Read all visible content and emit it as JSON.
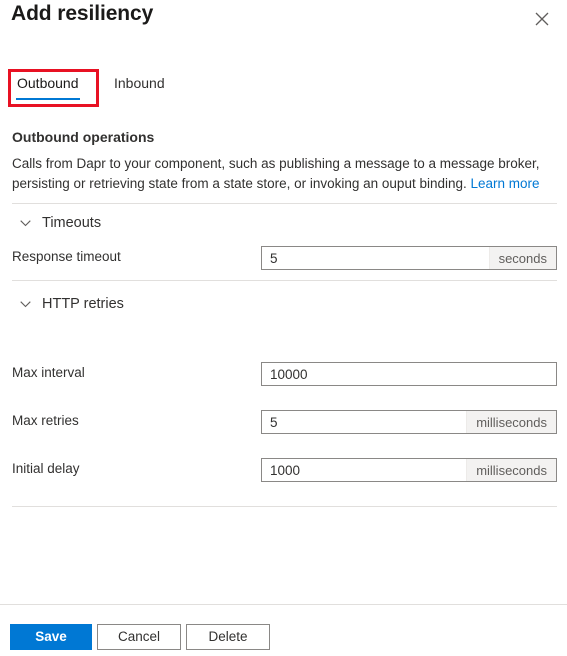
{
  "header": {
    "title": "Add resiliency",
    "close_icon": "close-icon"
  },
  "tabs": [
    {
      "id": "outbound",
      "label": "Outbound",
      "selected": true,
      "highlighted": true
    },
    {
      "id": "inbound",
      "label": "Inbound",
      "selected": false,
      "highlighted": false
    }
  ],
  "main": {
    "section_title": "Outbound operations",
    "description": "Calls from Dapr to your component, such as publishing a message to a message broker, persisting or retrieving state from a state store, or invoking an ouput binding.",
    "learn_more": "Learn more",
    "groups": [
      {
        "id": "timeouts",
        "label": "Timeouts",
        "expanded": true,
        "chevron_icon": "chevron-down-icon"
      },
      {
        "id": "http-retries",
        "label": "HTTP retries",
        "expanded": true,
        "chevron_icon": "chevron-down-icon"
      }
    ],
    "fields": [
      {
        "id": "response-timeout",
        "label": "Response timeout",
        "value": "5",
        "suffix": "seconds"
      },
      {
        "id": "max-interval",
        "label": "Max interval",
        "value": "10000",
        "suffix": ""
      },
      {
        "id": "max-retries",
        "label": "Max retries",
        "value": "5",
        "suffix": "milliseconds"
      },
      {
        "id": "initial-delay",
        "label": "Initial delay",
        "value": "1000",
        "suffix": "milliseconds"
      }
    ]
  },
  "footer": {
    "save_label": "Save",
    "cancel_label": "Cancel",
    "delete_label": "Delete"
  },
  "colors": {
    "accent": "#0078d4",
    "highlight": "#e81123",
    "text": "#323130",
    "divider": "#e1dfdd",
    "suffix_bg": "#f3f2f1"
  }
}
